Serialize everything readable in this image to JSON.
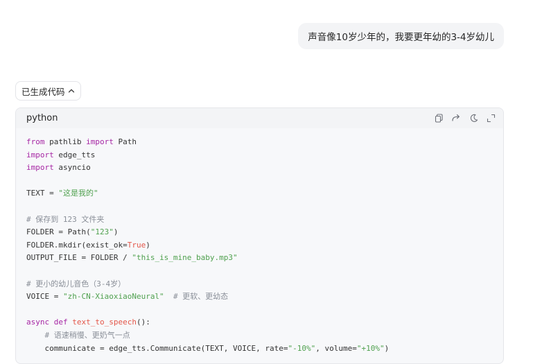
{
  "user_message": "声音像10岁少年的，我要更年幼的3-4岁幼儿",
  "code_toggle": {
    "label": "已生成代码",
    "icon": "chevron-up-icon"
  },
  "code_block": {
    "language": "python",
    "toolbar_icons": [
      "copy-icon",
      "redo-icon",
      "dark-mode-icon",
      "expand-icon"
    ],
    "lines": [
      [
        {
          "t": "kw",
          "v": "from"
        },
        {
          "t": "plain",
          "v": " pathlib "
        },
        {
          "t": "kw",
          "v": "import"
        },
        {
          "t": "plain",
          "v": " Path"
        }
      ],
      [
        {
          "t": "kw",
          "v": "import"
        },
        {
          "t": "plain",
          "v": " edge_tts"
        }
      ],
      [
        {
          "t": "kw",
          "v": "import"
        },
        {
          "t": "plain",
          "v": " asyncio"
        }
      ],
      [],
      [
        {
          "t": "plain",
          "v": "TEXT = "
        },
        {
          "t": "str",
          "v": "\"这是我的\""
        }
      ],
      [],
      [
        {
          "t": "com",
          "v": "# 保存到 123 文件夹"
        }
      ],
      [
        {
          "t": "plain",
          "v": "FOLDER = Path("
        },
        {
          "t": "str",
          "v": "\"123\""
        },
        {
          "t": "plain",
          "v": ")"
        }
      ],
      [
        {
          "t": "plain",
          "v": "FOLDER.mkdir(exist_ok="
        },
        {
          "t": "bool",
          "v": "True"
        },
        {
          "t": "plain",
          "v": ")"
        }
      ],
      [
        {
          "t": "plain",
          "v": "OUTPUT_FILE = FOLDER / "
        },
        {
          "t": "str",
          "v": "\"this_is_mine_baby.mp3\""
        }
      ],
      [],
      [
        {
          "t": "com",
          "v": "# 更小的幼儿音色（3-4岁）"
        }
      ],
      [
        {
          "t": "plain",
          "v": "VOICE = "
        },
        {
          "t": "str",
          "v": "\"zh-CN-XiaoxiaoNeural\""
        },
        {
          "t": "plain",
          "v": "  "
        },
        {
          "t": "com",
          "v": "# 更软、更幼态"
        }
      ],
      [],
      [
        {
          "t": "kw",
          "v": "async"
        },
        {
          "t": "plain",
          "v": " "
        },
        {
          "t": "kw",
          "v": "def"
        },
        {
          "t": "plain",
          "v": " "
        },
        {
          "t": "fn",
          "v": "text_to_speech"
        },
        {
          "t": "plain",
          "v": "():"
        }
      ],
      [
        {
          "t": "plain",
          "v": "    "
        },
        {
          "t": "com",
          "v": "# 语速稍慢、更奶气一点"
        }
      ],
      [
        {
          "t": "plain",
          "v": "    communicate = edge_tts.Communicate(TEXT, VOICE, rate="
        },
        {
          "t": "str",
          "v": "\"-10%\""
        },
        {
          "t": "plain",
          "v": ", volume="
        },
        {
          "t": "str",
          "v": "\"+10%\""
        },
        {
          "t": "plain",
          "v": ")"
        }
      ]
    ]
  },
  "colors": {
    "keyword": "#a626a4",
    "string": "#50a14f",
    "comment": "#8a8f98",
    "function": "#e45649",
    "bubble_bg": "#f3f4f6",
    "code_bg": "#f7f8fa"
  }
}
